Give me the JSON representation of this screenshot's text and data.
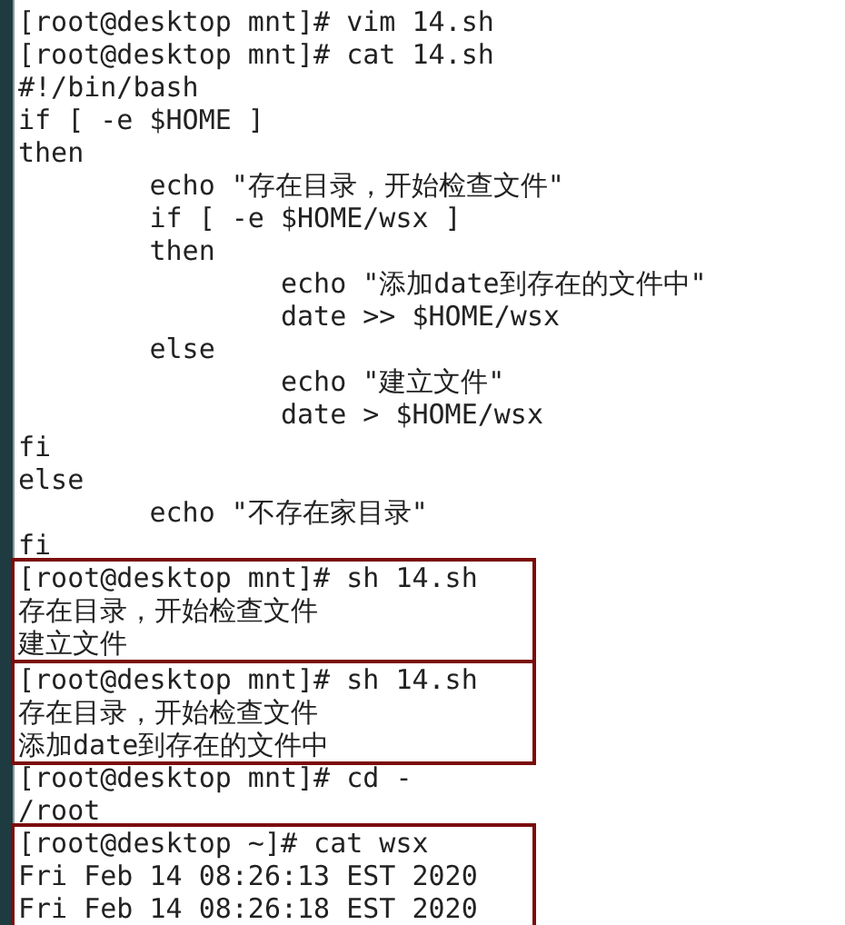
{
  "terminal": {
    "blocks": [
      {
        "highlighted": false,
        "lines": [
          "[root@desktop mnt]# vim 14.sh",
          "[root@desktop mnt]# cat 14.sh",
          "#!/bin/bash",
          "if [ -e $HOME ]",
          "then",
          "\techo \"存在目录，开始检查文件\"",
          "\tif [ -e $HOME/wsx ]",
          "\tthen",
          "\t\techo \"添加date到存在的文件中\"",
          "\t\tdate >> $HOME/wsx",
          "\telse",
          "\t\techo \"建立文件\"",
          "\t\tdate > $HOME/wsx",
          "fi",
          "else",
          "\techo \"不存在家目录\"",
          "fi"
        ]
      },
      {
        "highlighted": true,
        "lines": [
          "[root@desktop mnt]# sh 14.sh",
          "存在目录，开始检查文件",
          "建立文件"
        ]
      },
      {
        "highlighted": true,
        "lines": [
          "[root@desktop mnt]# sh 14.sh",
          "存在目录，开始检查文件",
          "添加date到存在的文件中"
        ]
      },
      {
        "highlighted": false,
        "lines": [
          "[root@desktop mnt]# cd -",
          "/root"
        ]
      },
      {
        "highlighted": true,
        "lines": [
          "[root@desktop ~]# cat wsx",
          "Fri Feb 14 08:26:13 EST 2020",
          "Fri Feb 14 08:26:18 EST 2020"
        ]
      }
    ]
  }
}
